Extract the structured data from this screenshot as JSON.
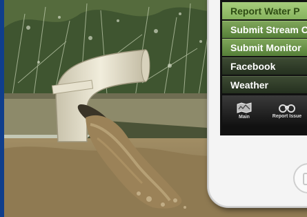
{
  "menu": {
    "items": [
      {
        "label": "Report Water P"
      },
      {
        "label": "Submit Stream C"
      },
      {
        "label": "Submit Monitor"
      },
      {
        "label": "Facebook"
      },
      {
        "label": "Weather"
      }
    ]
  },
  "tabbar": {
    "tabs": [
      {
        "label": "Main",
        "icon": "map-icon"
      },
      {
        "label": "Report Issue",
        "icon": "binoculars-icon"
      }
    ]
  },
  "colors": {
    "accent_green": "#86b25d",
    "menu_green": "#557f38",
    "menu_dark": "#25301f",
    "left_bar": "#0f3e8c"
  }
}
